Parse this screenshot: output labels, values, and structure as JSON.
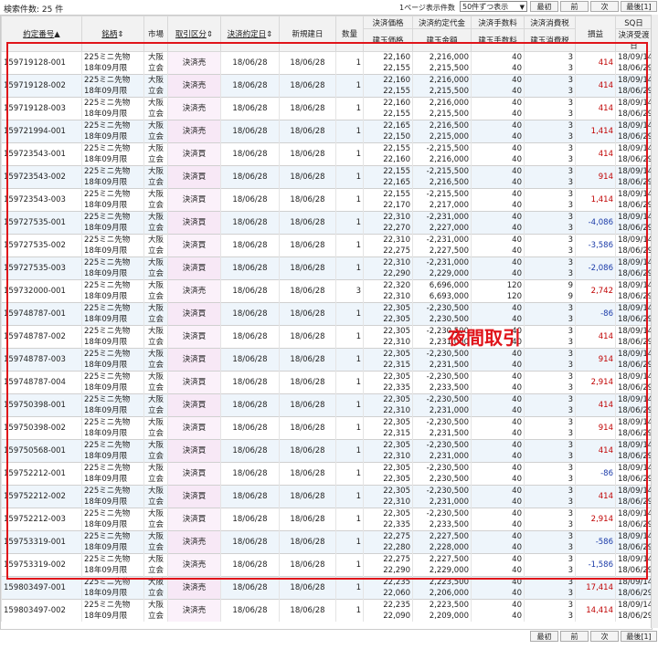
{
  "header": {
    "result_count": "検索件数: 25 件",
    "per_page_label": "1ページ表示件数",
    "per_page_value": "50件ずつ表示",
    "pager": {
      "first": "最初",
      "prev": "前",
      "next": "次",
      "last": "最後[1]"
    }
  },
  "columns": {
    "contract_no": "約定番号",
    "issue": "銘柄",
    "market": "市場",
    "trade_type": "取引区分",
    "settle_date": "決済約定日",
    "new_date": "新規建日",
    "qty": "数量",
    "settle_price": "決済価格",
    "open_price": "建玉価格",
    "settle_amount": "決済約定代金",
    "open_amount": "建玉金額",
    "settle_fee": "決済手数料",
    "open_fee": "建玉手数料",
    "settle_tax": "決済消費税",
    "open_tax": "建玉消費税",
    "pnl": "損益",
    "sq_date": "SQ日",
    "delivery_date": "決済受渡日"
  },
  "annotation": "夜間取引",
  "rows": [
    {
      "no": "159719128-001",
      "issue1": "225ミニ先物",
      "issue2": "18年09月限",
      "m1": "大阪",
      "m2": "立会",
      "type": "決済売",
      "sd": "18/06/28",
      "nd": "18/06/28",
      "qty": "1",
      "sp": "22,160",
      "op": "22,155",
      "sa": "2,216,000",
      "oa": "2,215,500",
      "sf": "40",
      "of": "40",
      "st": "3",
      "ot": "3",
      "pnl": "414",
      "sign": "pos",
      "sq": "18/09/14",
      "dd": "18/06/29"
    },
    {
      "no": "159719128-002",
      "issue1": "225ミニ先物",
      "issue2": "18年09月限",
      "m1": "大阪",
      "m2": "立会",
      "type": "決済売",
      "sd": "18/06/28",
      "nd": "18/06/28",
      "qty": "1",
      "sp": "22,160",
      "op": "22,155",
      "sa": "2,216,000",
      "oa": "2,215,500",
      "sf": "40",
      "of": "40",
      "st": "3",
      "ot": "3",
      "pnl": "414",
      "sign": "pos",
      "sq": "18/09/14",
      "dd": "18/06/29"
    },
    {
      "no": "159719128-003",
      "issue1": "225ミニ先物",
      "issue2": "18年09月限",
      "m1": "大阪",
      "m2": "立会",
      "type": "決済売",
      "sd": "18/06/28",
      "nd": "18/06/28",
      "qty": "1",
      "sp": "22,160",
      "op": "22,155",
      "sa": "2,216,000",
      "oa": "2,215,500",
      "sf": "40",
      "of": "40",
      "st": "3",
      "ot": "3",
      "pnl": "414",
      "sign": "pos",
      "sq": "18/09/14",
      "dd": "18/06/29"
    },
    {
      "no": "159721994-001",
      "issue1": "225ミニ先物",
      "issue2": "18年09月限",
      "m1": "大阪",
      "m2": "立会",
      "type": "決済売",
      "sd": "18/06/28",
      "nd": "18/06/28",
      "qty": "1",
      "sp": "22,165",
      "op": "22,150",
      "sa": "2,216,500",
      "oa": "2,215,000",
      "sf": "40",
      "of": "40",
      "st": "3",
      "ot": "3",
      "pnl": "1,414",
      "sign": "pos",
      "sq": "18/09/14",
      "dd": "18/06/29"
    },
    {
      "no": "159723543-001",
      "issue1": "225ミニ先物",
      "issue2": "18年09月限",
      "m1": "大阪",
      "m2": "立会",
      "type": "決済買",
      "sd": "18/06/28",
      "nd": "18/06/28",
      "qty": "1",
      "sp": "22,155",
      "op": "22,160",
      "sa": "-2,215,500",
      "oa": "2,216,000",
      "sf": "40",
      "of": "40",
      "st": "3",
      "ot": "3",
      "pnl": "414",
      "sign": "pos",
      "sq": "18/09/14",
      "dd": "18/06/29"
    },
    {
      "no": "159723543-002",
      "issue1": "225ミニ先物",
      "issue2": "18年09月限",
      "m1": "大阪",
      "m2": "立会",
      "type": "決済買",
      "sd": "18/06/28",
      "nd": "18/06/28",
      "qty": "1",
      "sp": "22,155",
      "op": "22,165",
      "sa": "-2,215,500",
      "oa": "2,216,500",
      "sf": "40",
      "of": "40",
      "st": "3",
      "ot": "3",
      "pnl": "914",
      "sign": "pos",
      "sq": "18/09/14",
      "dd": "18/06/29"
    },
    {
      "no": "159723543-003",
      "issue1": "225ミニ先物",
      "issue2": "18年09月限",
      "m1": "大阪",
      "m2": "立会",
      "type": "決済買",
      "sd": "18/06/28",
      "nd": "18/06/28",
      "qty": "1",
      "sp": "22,155",
      "op": "22,170",
      "sa": "-2,215,500",
      "oa": "2,217,000",
      "sf": "40",
      "of": "40",
      "st": "3",
      "ot": "3",
      "pnl": "1,414",
      "sign": "pos",
      "sq": "18/09/14",
      "dd": "18/06/29"
    },
    {
      "no": "159727535-001",
      "issue1": "225ミニ先物",
      "issue2": "18年09月限",
      "m1": "大阪",
      "m2": "立会",
      "type": "決済買",
      "sd": "18/06/28",
      "nd": "18/06/28",
      "qty": "1",
      "sp": "22,310",
      "op": "22,270",
      "sa": "-2,231,000",
      "oa": "2,227,000",
      "sf": "40",
      "of": "40",
      "st": "3",
      "ot": "3",
      "pnl": "-4,086",
      "sign": "neg",
      "sq": "18/09/14",
      "dd": "18/06/29"
    },
    {
      "no": "159727535-002",
      "issue1": "225ミニ先物",
      "issue2": "18年09月限",
      "m1": "大阪",
      "m2": "立会",
      "type": "決済買",
      "sd": "18/06/28",
      "nd": "18/06/28",
      "qty": "1",
      "sp": "22,310",
      "op": "22,275",
      "sa": "-2,231,000",
      "oa": "2,227,500",
      "sf": "40",
      "of": "40",
      "st": "3",
      "ot": "3",
      "pnl": "-3,586",
      "sign": "neg",
      "sq": "18/09/14",
      "dd": "18/06/29"
    },
    {
      "no": "159727535-003",
      "issue1": "225ミニ先物",
      "issue2": "18年09月限",
      "m1": "大阪",
      "m2": "立会",
      "type": "決済買",
      "sd": "18/06/28",
      "nd": "18/06/28",
      "qty": "1",
      "sp": "22,310",
      "op": "22,290",
      "sa": "-2,231,000",
      "oa": "2,229,000",
      "sf": "40",
      "of": "40",
      "st": "3",
      "ot": "3",
      "pnl": "-2,086",
      "sign": "neg",
      "sq": "18/09/14",
      "dd": "18/06/29"
    },
    {
      "no": "159732000-001",
      "issue1": "225ミニ先物",
      "issue2": "18年09月限",
      "m1": "大阪",
      "m2": "立会",
      "type": "決済売",
      "sd": "18/06/28",
      "nd": "18/06/28",
      "qty": "3",
      "sp": "22,320",
      "op": "22,310",
      "sa": "6,696,000",
      "oa": "6,693,000",
      "sf": "120",
      "of": "120",
      "st": "9",
      "ot": "9",
      "pnl": "2,742",
      "sign": "pos",
      "sq": "18/09/14",
      "dd": "18/06/29"
    },
    {
      "no": "159748787-001",
      "issue1": "225ミニ先物",
      "issue2": "18年09月限",
      "m1": "大阪",
      "m2": "立会",
      "type": "決済買",
      "sd": "18/06/28",
      "nd": "18/06/28",
      "qty": "1",
      "sp": "22,305",
      "op": "22,305",
      "sa": "-2,230,500",
      "oa": "2,230,500",
      "sf": "40",
      "of": "40",
      "st": "3",
      "ot": "3",
      "pnl": "-86",
      "sign": "neg",
      "sq": "18/09/14",
      "dd": "18/06/29"
    },
    {
      "no": "159748787-002",
      "issue1": "225ミニ先物",
      "issue2": "18年09月限",
      "m1": "大阪",
      "m2": "立会",
      "type": "決済買",
      "sd": "18/06/28",
      "nd": "18/06/28",
      "qty": "1",
      "sp": "22,305",
      "op": "22,310",
      "sa": "-2,230,500",
      "oa": "2,231,000",
      "sf": "40",
      "of": "40",
      "st": "3",
      "ot": "3",
      "pnl": "414",
      "sign": "pos",
      "sq": "18/09/14",
      "dd": "18/06/29"
    },
    {
      "no": "159748787-003",
      "issue1": "225ミニ先物",
      "issue2": "18年09月限",
      "m1": "大阪",
      "m2": "立会",
      "type": "決済買",
      "sd": "18/06/28",
      "nd": "18/06/28",
      "qty": "1",
      "sp": "22,305",
      "op": "22,315",
      "sa": "-2,230,500",
      "oa": "2,231,500",
      "sf": "40",
      "of": "40",
      "st": "3",
      "ot": "3",
      "pnl": "914",
      "sign": "pos",
      "sq": "18/09/14",
      "dd": "18/06/29"
    },
    {
      "no": "159748787-004",
      "issue1": "225ミニ先物",
      "issue2": "18年09月限",
      "m1": "大阪",
      "m2": "立会",
      "type": "決済買",
      "sd": "18/06/28",
      "nd": "18/06/28",
      "qty": "1",
      "sp": "22,305",
      "op": "22,335",
      "sa": "-2,230,500",
      "oa": "2,233,500",
      "sf": "40",
      "of": "40",
      "st": "3",
      "ot": "3",
      "pnl": "2,914",
      "sign": "pos",
      "sq": "18/09/14",
      "dd": "18/06/29"
    },
    {
      "no": "159750398-001",
      "issue1": "225ミニ先物",
      "issue2": "18年09月限",
      "m1": "大阪",
      "m2": "立会",
      "type": "決済買",
      "sd": "18/06/28",
      "nd": "18/06/28",
      "qty": "1",
      "sp": "22,305",
      "op": "22,310",
      "sa": "-2,230,500",
      "oa": "2,231,000",
      "sf": "40",
      "of": "40",
      "st": "3",
      "ot": "3",
      "pnl": "414",
      "sign": "pos",
      "sq": "18/09/14",
      "dd": "18/06/29"
    },
    {
      "no": "159750398-002",
      "issue1": "225ミニ先物",
      "issue2": "18年09月限",
      "m1": "大阪",
      "m2": "立会",
      "type": "決済買",
      "sd": "18/06/28",
      "nd": "18/06/28",
      "qty": "1",
      "sp": "22,305",
      "op": "22,315",
      "sa": "-2,230,500",
      "oa": "2,231,500",
      "sf": "40",
      "of": "40",
      "st": "3",
      "ot": "3",
      "pnl": "914",
      "sign": "pos",
      "sq": "18/09/14",
      "dd": "18/06/29"
    },
    {
      "no": "159750568-001",
      "issue1": "225ミニ先物",
      "issue2": "18年09月限",
      "m1": "大阪",
      "m2": "立会",
      "type": "決済買",
      "sd": "18/06/28",
      "nd": "18/06/28",
      "qty": "1",
      "sp": "22,305",
      "op": "22,310",
      "sa": "-2,230,500",
      "oa": "2,231,000",
      "sf": "40",
      "of": "40",
      "st": "3",
      "ot": "3",
      "pnl": "414",
      "sign": "pos",
      "sq": "18/09/14",
      "dd": "18/06/29"
    },
    {
      "no": "159752212-001",
      "issue1": "225ミニ先物",
      "issue2": "18年09月限",
      "m1": "大阪",
      "m2": "立会",
      "type": "決済買",
      "sd": "18/06/28",
      "nd": "18/06/28",
      "qty": "1",
      "sp": "22,305",
      "op": "22,305",
      "sa": "-2,230,500",
      "oa": "2,230,500",
      "sf": "40",
      "of": "40",
      "st": "3",
      "ot": "3",
      "pnl": "-86",
      "sign": "neg",
      "sq": "18/09/14",
      "dd": "18/06/29"
    },
    {
      "no": "159752212-002",
      "issue1": "225ミニ先物",
      "issue2": "18年09月限",
      "m1": "大阪",
      "m2": "立会",
      "type": "決済買",
      "sd": "18/06/28",
      "nd": "18/06/28",
      "qty": "1",
      "sp": "22,305",
      "op": "22,310",
      "sa": "-2,230,500",
      "oa": "2,231,000",
      "sf": "40",
      "of": "40",
      "st": "3",
      "ot": "3",
      "pnl": "414",
      "sign": "pos",
      "sq": "18/09/14",
      "dd": "18/06/29"
    },
    {
      "no": "159752212-003",
      "issue1": "225ミニ先物",
      "issue2": "18年09月限",
      "m1": "大阪",
      "m2": "立会",
      "type": "決済買",
      "sd": "18/06/28",
      "nd": "18/06/28",
      "qty": "1",
      "sp": "22,305",
      "op": "22,335",
      "sa": "-2,230,500",
      "oa": "2,233,500",
      "sf": "40",
      "of": "40",
      "st": "3",
      "ot": "3",
      "pnl": "2,914",
      "sign": "pos",
      "sq": "18/09/14",
      "dd": "18/06/29"
    },
    {
      "no": "159753319-001",
      "issue1": "225ミニ先物",
      "issue2": "18年09月限",
      "m1": "大阪",
      "m2": "立会",
      "type": "決済売",
      "sd": "18/06/28",
      "nd": "18/06/28",
      "qty": "1",
      "sp": "22,275",
      "op": "22,280",
      "sa": "2,227,500",
      "oa": "2,228,000",
      "sf": "40",
      "of": "40",
      "st": "3",
      "ot": "3",
      "pnl": "-586",
      "sign": "neg",
      "sq": "18/09/14",
      "dd": "18/06/29"
    },
    {
      "no": "159753319-002",
      "issue1": "225ミニ先物",
      "issue2": "18年09月限",
      "m1": "大阪",
      "m2": "立会",
      "type": "決済売",
      "sd": "18/06/28",
      "nd": "18/06/28",
      "qty": "1",
      "sp": "22,275",
      "op": "22,290",
      "sa": "2,227,500",
      "oa": "2,229,000",
      "sf": "40",
      "of": "40",
      "st": "3",
      "ot": "3",
      "pnl": "-1,586",
      "sign": "neg",
      "sq": "18/09/14",
      "dd": "18/06/29"
    },
    {
      "no": "159803497-001",
      "issue1": "225ミニ先物",
      "issue2": "18年09月限",
      "m1": "大阪",
      "m2": "立会",
      "type": "決済売",
      "sd": "18/06/28",
      "nd": "18/06/28",
      "qty": "1",
      "sp": "22,235",
      "op": "22,060",
      "sa": "2,223,500",
      "oa": "2,206,000",
      "sf": "40",
      "of": "40",
      "st": "3",
      "ot": "3",
      "pnl": "17,414",
      "sign": "pos",
      "sq": "18/09/14",
      "dd": "18/06/29"
    },
    {
      "no": "159803497-002",
      "issue1": "225ミニ先物",
      "issue2": "18年09月限",
      "m1": "大阪",
      "m2": "立会",
      "type": "決済売",
      "sd": "18/06/28",
      "nd": "18/06/28",
      "qty": "1",
      "sp": "22,235",
      "op": "22,090",
      "sa": "2,223,500",
      "oa": "2,209,000",
      "sf": "40",
      "of": "40",
      "st": "3",
      "ot": "3",
      "pnl": "14,414",
      "sign": "pos",
      "sq": "18/09/14",
      "dd": "18/06/29"
    }
  ]
}
